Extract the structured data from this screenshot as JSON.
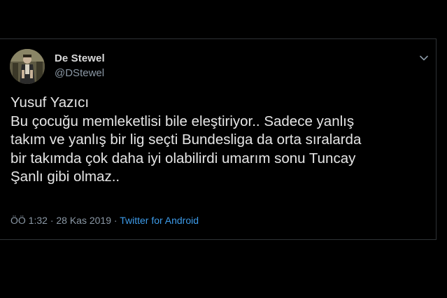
{
  "user": {
    "display_name": "De Stewel",
    "handle": "@DStewel"
  },
  "icons": {
    "menu": "chevron-down-icon",
    "avatar": "profile-photo"
  },
  "tweet": {
    "lines": [
      "Yusuf Yazıcı",
      "Bu çocuğu memleketlisi bile eleştiriyor.. Sadece yanlış",
      "takım ve yanlış bir lig seçti Bundesliga da orta sıralarda",
      "bir takımda çok daha iyi olabilirdi umarım sonu Tuncay",
      "Şanlı gibi olmaz.."
    ]
  },
  "meta": {
    "time": "ÖÖ 1:32",
    "separator": "·",
    "date": "28 Kas 2019",
    "source": "Twitter for Android"
  },
  "colors": {
    "background": "#000000",
    "text": "#e6e6e6",
    "muted": "#8b98a5",
    "link": "#3d9be9",
    "border": "#2f3336"
  }
}
